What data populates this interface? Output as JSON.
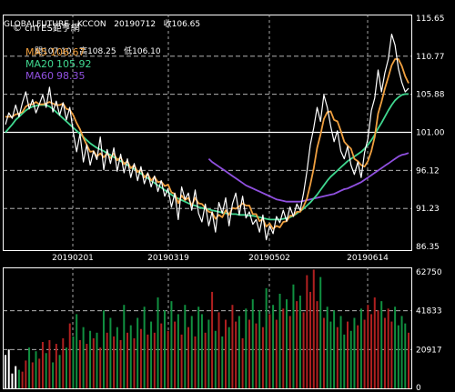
{
  "header": {
    "line1": "GLOBALFUTURE - KCCON   20190712   收106.65",
    "line2": "開107.10   高108.25   低106.10"
  },
  "watermark": "© cnYES鉅亨網",
  "colors": {
    "close": "#ffffff",
    "ma5": "#f0a040",
    "ma20": "#40d890",
    "ma60": "#9050e0",
    "volume_up": "#b02020",
    "volume_down": "#109040",
    "grid": "#cccccc"
  },
  "chart_data": [
    {
      "type": "line",
      "title": "GLOBALFUTURE - KCCON",
      "ylim": [
        86.35,
        115.65
      ],
      "yticks": [
        "115.65",
        "110.77",
        "105.88",
        "101.00",
        "96.12",
        "91.23",
        "86.35"
      ],
      "xticks": [
        "20190201",
        "20190319",
        "20190502",
        "20190614"
      ],
      "legend": [
        {
          "name": "MA5",
          "value": "106.67"
        },
        {
          "name": "MA20",
          "value": "105.92"
        },
        {
          "name": "MA60",
          "value": "98.35"
        }
      ],
      "series": [
        {
          "name": "Close",
          "values": [
            102.0,
            103.5,
            102.8,
            104.5,
            103.0,
            104.8,
            106.2,
            104.0,
            105.2,
            103.5,
            104.6,
            105.8,
            104.2,
            106.8,
            103.6,
            105.0,
            103.2,
            104.8,
            102.6,
            104.2,
            101.0,
            98.5,
            100.8,
            97.2,
            99.4,
            96.8,
            98.6,
            97.5,
            100.4,
            96.2,
            98.8,
            97.0,
            99.0,
            96.0,
            98.2,
            95.8,
            97.6,
            95.2,
            97.0,
            94.8,
            96.6,
            94.4,
            95.8,
            94.0,
            95.4,
            93.4,
            94.8,
            92.8,
            93.8,
            91.4,
            93.2,
            89.8,
            94.0,
            92.4,
            93.2,
            91.0,
            93.6,
            90.6,
            89.5,
            91.8,
            89.0,
            90.8,
            88.2,
            92.0,
            90.6,
            92.6,
            89.0,
            91.8,
            93.2,
            90.4,
            92.8,
            90.0,
            90.8,
            89.2,
            89.8,
            88.2,
            90.4,
            87.2,
            89.0,
            88.0,
            90.2,
            89.4,
            91.0,
            89.6,
            91.4,
            90.2,
            91.8,
            91.0,
            93.2,
            96.0,
            99.4,
            101.6,
            104.2,
            102.4,
            105.8,
            104.2,
            101.8,
            99.8,
            101.2,
            98.6,
            97.6,
            99.2,
            96.8,
            95.6,
            97.2,
            95.2,
            98.4,
            100.2,
            103.8,
            105.4,
            109.0,
            106.2,
            108.6,
            110.4,
            113.6,
            112.2,
            109.2,
            107.4,
            106.2,
            106.65
          ]
        },
        {
          "name": "MA5",
          "values": [
            103.0,
            103.0,
            103.0,
            103.3,
            103.4,
            103.6,
            104.3,
            104.6,
            104.6,
            104.9,
            104.6,
            104.6,
            104.7,
            104.9,
            104.7,
            104.5,
            104.5,
            104.7,
            104.0,
            103.9,
            103.2,
            102.2,
            101.4,
            100.3,
            99.4,
            98.5,
            98.6,
            97.9,
            98.3,
            97.8,
            98.3,
            97.7,
            98.3,
            97.4,
            97.8,
            96.9,
            97.3,
            96.4,
            96.8,
            95.9,
            96.2,
            95.2,
            95.7,
            94.8,
            95.3,
            94.6,
            94.7,
            94.1,
            94.3,
            93.3,
            93.1,
            91.9,
            92.9,
            92.3,
            92.6,
            91.6,
            92.6,
            91.9,
            91.8,
            91.3,
            90.8,
            90.7,
            89.9,
            90.4,
            90.1,
            91.0,
            90.4,
            91.3,
            91.2,
            91.5,
            91.9,
            91.6,
            91.6,
            90.5,
            90.5,
            89.6,
            89.9,
            88.9,
            89.3,
            88.6,
            89.0,
            88.8,
            89.5,
            89.6,
            90.3,
            90.3,
            90.8,
            90.8,
            91.5,
            92.5,
            94.3,
            96.4,
            99.0,
            100.7,
            102.7,
            103.6,
            103.7,
            102.6,
            102.4,
            101.2,
            99.8,
            99.3,
            98.9,
            97.6,
            97.3,
            96.8,
            96.6,
            97.3,
            98.6,
            100.4,
            103.4,
            104.9,
            106.6,
            108.1,
            109.6,
            110.4,
            110.4,
            109.5,
            108.2,
            107.3
          ]
        },
        {
          "name": "MA20",
          "values": [
            101.0,
            101.5,
            102.0,
            102.6,
            103.0,
            103.4,
            103.8,
            104.1,
            104.3,
            104.4,
            104.5,
            104.5,
            104.5,
            104.3,
            104.0,
            103.6,
            103.2,
            102.8,
            102.4,
            102.0,
            101.6,
            101.2,
            100.8,
            100.4,
            100.0,
            99.6,
            99.3,
            99.0,
            98.8,
            98.6,
            98.3,
            98.1,
            97.8,
            97.6,
            97.3,
            97.1,
            96.8,
            96.5,
            96.3,
            96.0,
            95.7,
            95.4,
            95.1,
            94.8,
            94.5,
            94.2,
            93.9,
            93.6,
            93.3,
            93.0,
            92.7,
            92.5,
            92.3,
            92.1,
            91.9,
            91.7,
            91.6,
            91.4,
            91.3,
            91.2,
            91.1,
            91.0,
            90.9,
            90.8,
            90.7,
            90.6,
            90.6,
            90.5,
            90.5,
            90.4,
            90.4,
            90.4,
            90.3,
            90.3,
            90.2,
            90.1,
            90.0,
            89.9,
            89.8,
            89.8,
            89.8,
            89.8,
            89.9,
            90.0,
            90.1,
            90.3,
            90.6,
            90.9,
            91.2,
            91.6,
            92.0,
            92.5,
            93.0,
            93.6,
            94.2,
            94.8,
            95.3,
            95.7,
            96.1,
            96.5,
            96.9,
            97.3,
            97.6,
            97.9,
            98.2,
            98.5,
            98.9,
            99.4,
            100.0,
            100.7,
            101.5,
            102.2,
            103.0,
            103.8,
            104.5,
            105.1,
            105.5,
            105.8,
            105.92,
            105.92
          ]
        },
        {
          "name": "MA60",
          "values": [
            null,
            null,
            null,
            null,
            null,
            null,
            null,
            null,
            null,
            null,
            null,
            null,
            null,
            null,
            null,
            null,
            null,
            null,
            null,
            null,
            null,
            null,
            null,
            null,
            null,
            null,
            null,
            null,
            null,
            null,
            null,
            null,
            null,
            null,
            null,
            null,
            null,
            null,
            null,
            null,
            null,
            null,
            null,
            null,
            null,
            null,
            null,
            null,
            null,
            null,
            null,
            null,
            null,
            null,
            null,
            null,
            null,
            null,
            null,
            null,
            97.6,
            97.2,
            96.9,
            96.6,
            96.3,
            96.0,
            95.7,
            95.4,
            95.1,
            94.8,
            94.5,
            94.2,
            94.0,
            93.8,
            93.6,
            93.4,
            93.2,
            93.0,
            92.8,
            92.6,
            92.4,
            92.3,
            92.2,
            92.1,
            92.1,
            92.1,
            92.1,
            92.1,
            92.2,
            92.3,
            92.4,
            92.5,
            92.6,
            92.7,
            92.8,
            92.9,
            93.0,
            93.1,
            93.3,
            93.5,
            93.7,
            93.8,
            94.0,
            94.2,
            94.4,
            94.6,
            94.9,
            95.2,
            95.5,
            95.8,
            96.1,
            96.4,
            96.7,
            97.0,
            97.3,
            97.6,
            97.9,
            98.1,
            98.2,
            98.35
          ]
        }
      ]
    },
    {
      "type": "bar",
      "ylim": [
        0,
        62750
      ],
      "yticks": [
        "62750",
        "41833",
        "20917",
        "0"
      ],
      "series": [
        {
          "name": "Volume",
          "values": [
            18000,
            21000,
            8000,
            12000,
            10000,
            9000,
            15000,
            22000,
            14000,
            20000,
            16000,
            25000,
            19000,
            26000,
            14000,
            24000,
            18000,
            27000,
            22000,
            35000,
            28000,
            40000,
            26000,
            33000,
            24000,
            31000,
            27000,
            30000,
            22000,
            42000,
            30000,
            38000,
            28000,
            33000,
            26000,
            45000,
            30000,
            34000,
            27000,
            38000,
            32000,
            44000,
            29000,
            36000,
            30000,
            49000,
            35000,
            42000,
            31000,
            47000,
            36000,
            40000,
            29000,
            45000,
            33000,
            39000,
            28000,
            44000,
            40000,
            30000,
            37000,
            52000,
            31000,
            41000,
            28000,
            37000,
            33000,
            45000,
            36000,
            39000,
            27000,
            43000,
            37000,
            48000,
            35000,
            42000,
            33000,
            54000,
            40000,
            45000,
            37000,
            51000,
            43000,
            48000,
            39000,
            56000,
            47000,
            50000,
            41000,
            61000,
            52000,
            64000,
            47000,
            60000,
            38000,
            44000,
            36000,
            42000,
            33000,
            39000,
            29000,
            36000,
            31000,
            38000,
            34000,
            43000,
            37000,
            45000,
            40000,
            49000,
            42000,
            47000,
            38000,
            43000,
            36000,
            44000,
            34000,
            39000,
            35000,
            30000
          ]
        }
      ]
    }
  ]
}
